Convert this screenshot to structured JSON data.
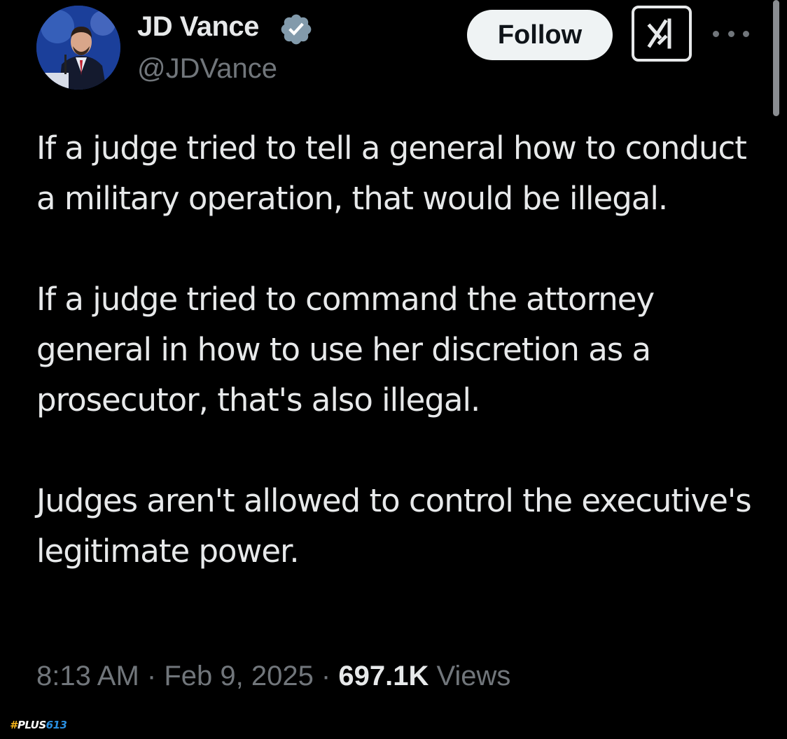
{
  "author": {
    "display_name": "JD Vance",
    "handle": "@JDVance",
    "verified": true
  },
  "actions": {
    "follow_label": "Follow",
    "grok_icon": "grok-icon",
    "more_icon": "more-options-icon"
  },
  "tweet": {
    "paragraphs": [
      "If a judge tried to tell a general how to conduct a military operation, that would be illegal.",
      "If a judge tried to command the attorney general in how to use her discretion as a prosecutor, that's also illegal.",
      "Judges aren't allowed to control the executive's legitimate power."
    ]
  },
  "meta": {
    "time": "8:13 AM",
    "separator": " · ",
    "date": "Feb 9, 2025",
    "views_count": "697.1K",
    "views_label": " Views"
  },
  "watermark": {
    "hash": "#",
    "text": "PLUS",
    "number": "613"
  },
  "colors": {
    "background": "#000000",
    "primary_text": "#e7e9ea",
    "secondary_text": "#71767b",
    "follow_bg": "#eff3f4",
    "verified_badge": "#829aab"
  }
}
